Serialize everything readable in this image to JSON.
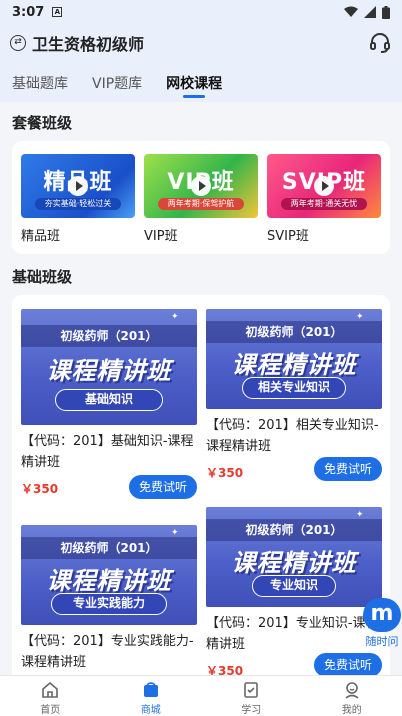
{
  "status_bar": {
    "time": "3:07",
    "badge": "A"
  },
  "header": {
    "title": "卫生资格初级师",
    "exchange_icon": "exchange-icon",
    "support_icon": "headset-icon"
  },
  "tabs": [
    {
      "label": "基础题库",
      "active": false
    },
    {
      "label": "VIP题库",
      "active": false
    },
    {
      "label": "网校课程",
      "active": true
    }
  ],
  "package_section": {
    "title": "套餐班级",
    "items": [
      {
        "banner": "精品班",
        "tagline": "夯实基础·轻松过关",
        "label": "精品班"
      },
      {
        "banner": "VIP班",
        "tagline": "两年考期·保驾护航",
        "label": "VIP班"
      },
      {
        "banner": "SVIP班",
        "tagline": "两年考期·通关无忧",
        "label": "SVIP班"
      }
    ]
  },
  "basic_section": {
    "title": "基础班级",
    "courses": [
      {
        "thumb_top": "初级药师（201）",
        "thumb_main": "课程精讲班",
        "thumb_pill": "基础知识",
        "title": "【代码：201】基础知识-课程精讲班",
        "price": "￥350",
        "button": "免费试听"
      },
      {
        "thumb_top": "初级药师（201）",
        "thumb_main": "课程精讲班",
        "thumb_pill": "相关专业知识",
        "title": "【代码：201】相关专业知识-课程精讲班",
        "price": "￥350",
        "button": "免费试听"
      },
      {
        "thumb_top": "初级药师（201）",
        "thumb_main": "课程精讲班",
        "thumb_pill": "专业实践能力",
        "title": "【代码：201】专业实践能力-课程精讲班",
        "price": "",
        "button": ""
      },
      {
        "thumb_top": "初级药师（201）",
        "thumb_main": "课程精讲班",
        "thumb_pill": "专业知识",
        "title": "【代码：201】专业知识-课程精讲班",
        "price": "￥350",
        "button": "免费试听"
      }
    ]
  },
  "floating": {
    "label": "随时问"
  },
  "bottom_nav": [
    {
      "label": "首页",
      "icon": "home-icon",
      "active": false
    },
    {
      "label": "商城",
      "icon": "shop-icon",
      "active": true
    },
    {
      "label": "学习",
      "icon": "study-icon",
      "active": false
    },
    {
      "label": "我的",
      "icon": "profile-icon",
      "active": false
    }
  ],
  "colors": {
    "accent": "#1e6fe6",
    "price": "#e33b2e"
  }
}
